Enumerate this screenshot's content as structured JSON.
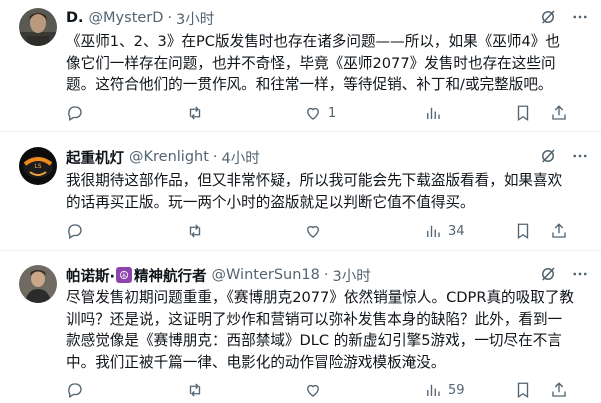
{
  "tweets": [
    {
      "name": "D.",
      "handle": "@MysterD",
      "dot": "·",
      "time": "3小时",
      "lines": [
        "《巫师1、2、3》在PC版发售时也存在诸多问题——所以，如果《巫师4》也",
        "像它们一样存在问题，也并不奇怪，毕竟《巫师2077》发售时也存在这些问",
        "题。这符合他们的一贯作风。和往常一样，等待促销、补丁和/或完整版吧。"
      ],
      "replies": "",
      "retweets": "",
      "likes": "1",
      "views": ""
    },
    {
      "name": "起重机灯",
      "handle": "@Krenlight",
      "dot": "·",
      "time": "4小时",
      "lines": [
        "我很期待这部作品，但又非常怀疑，所以我可能会先下载盗版看看，如果喜欢",
        "的话再买正版。玩一两个小时的盗版就足以判断它值不值得买。"
      ],
      "replies": "",
      "retweets": "",
      "likes": "",
      "views": "34"
    },
    {
      "name": "帕诺斯·",
      "badge": "☮",
      "name2": "精神航行者",
      "handle": "@WinterSun18",
      "dot": "·",
      "time": "3小时",
      "lines": [
        "尽管发售初期问题重重，《赛博朋克2077》依然销量惊人。CDPR真的吸取了教",
        "训吗？还是说，这证明了炒作和营销可以弥补发售本身的缺陷？此外，看到一",
        "款感觉像是《赛博朋克：西部禁域》DLC 的新虚幻引擎5游戏，一切尽在不言",
        "中。我们正被千篇一律、电影化的动作冒险游戏模板淹没。"
      ],
      "replies": "",
      "retweets": "",
      "likes": "",
      "views": "59"
    }
  ],
  "icons": {
    "grok": "grok-icon",
    "more": "more-icon",
    "reply": "reply-icon",
    "retweet": "retweet-icon",
    "like": "like-icon",
    "views": "views-icon",
    "bookmark": "bookmark-icon",
    "share": "share-icon"
  },
  "colors": {
    "text": "#0f1419",
    "secondary": "#536471",
    "divider": "#eff3f4",
    "badge": "#8e44ad"
  }
}
